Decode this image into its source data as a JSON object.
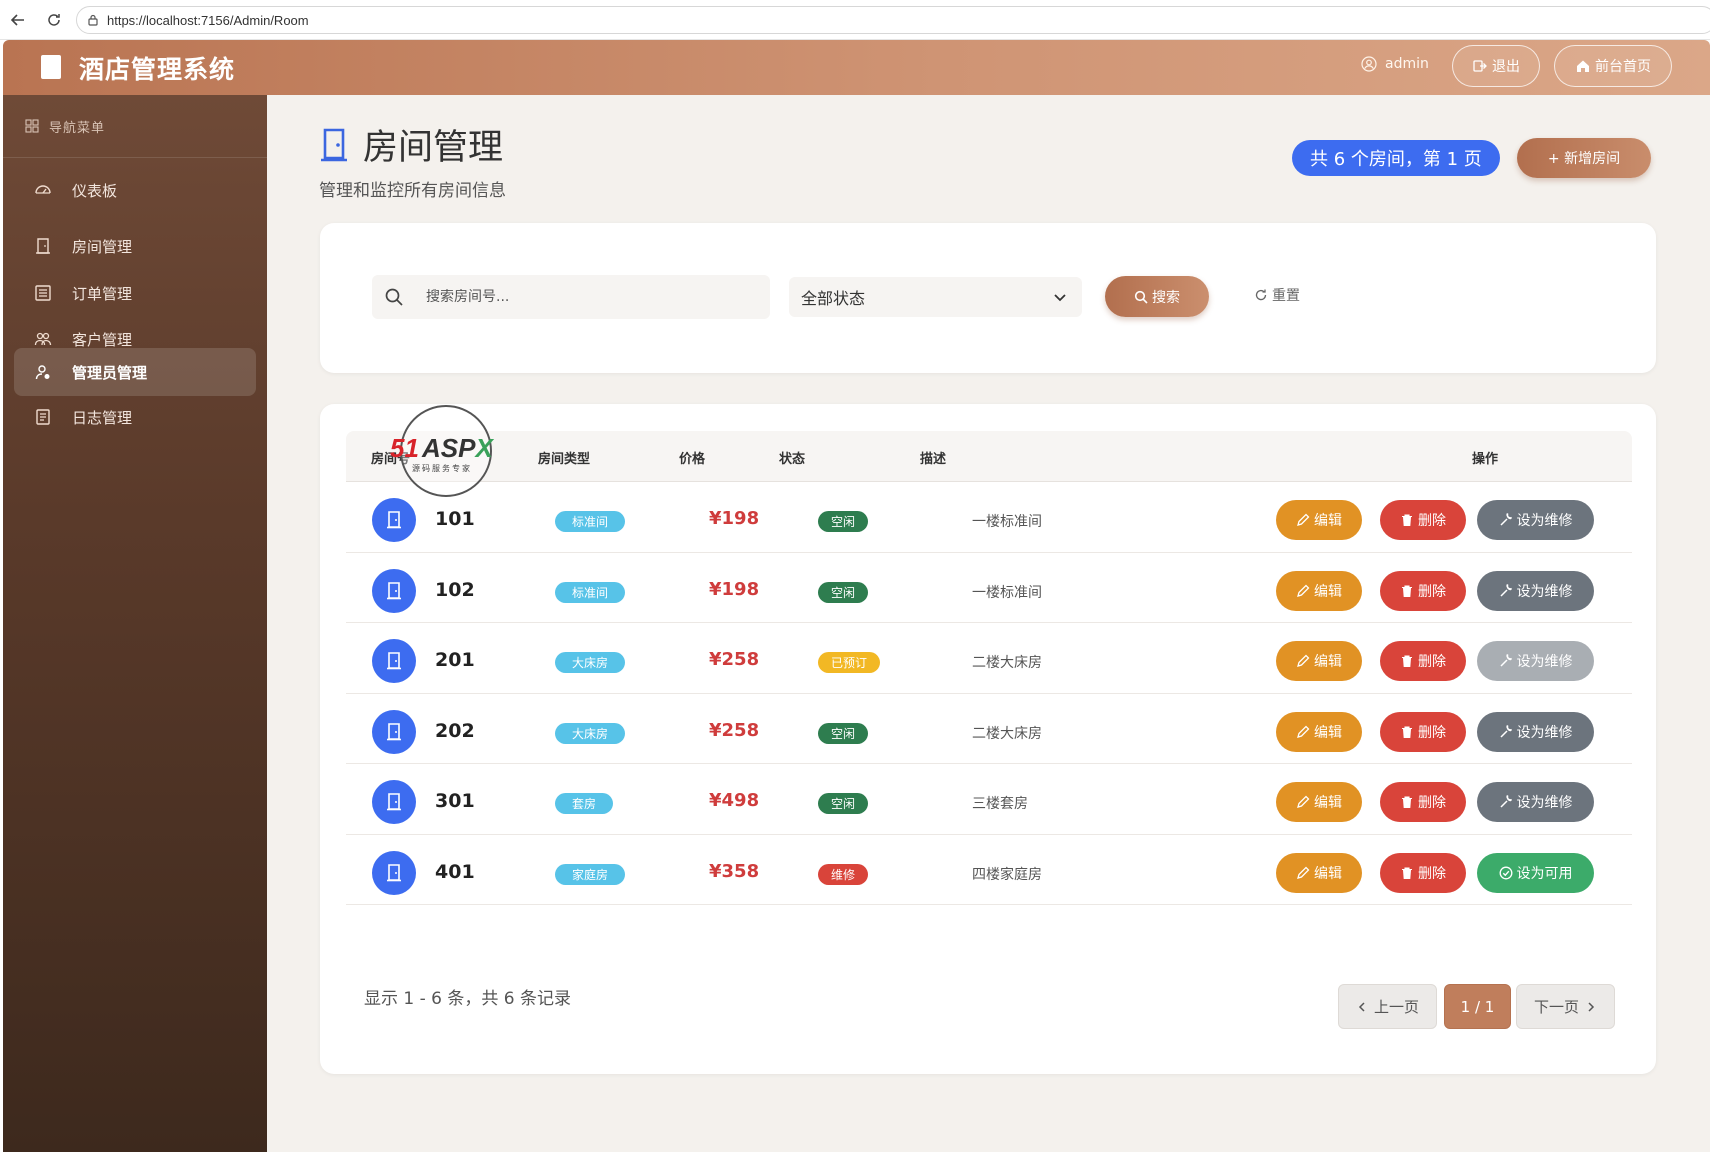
{
  "browser": {
    "url": "https://localhost:7156/Admin/Room"
  },
  "header": {
    "title": "酒店管理系统",
    "user": "admin",
    "logout_label": "退出",
    "front_label": "前台首页"
  },
  "sidebar": {
    "header": "导航菜单",
    "items": [
      {
        "label": "仪表板",
        "icon": "dashboard-icon"
      },
      {
        "label": "房间管理",
        "icon": "door-icon"
      },
      {
        "label": "订单管理",
        "icon": "order-icon"
      },
      {
        "label": "客户管理",
        "icon": "customers-icon"
      },
      {
        "label": "管理员管理",
        "icon": "admin-icon",
        "active": true
      },
      {
        "label": "日志管理",
        "icon": "log-icon"
      }
    ]
  },
  "page": {
    "title": "房间管理",
    "subtitle": "管理和监控所有房间信息",
    "count_badge": "共 6 个房间，第 1 页",
    "add_label": "+ 新增房间"
  },
  "search": {
    "placeholder": "搜索房间号...",
    "status_selected": "全部状态",
    "search_label": "搜索",
    "reset_label": "重置"
  },
  "table": {
    "headers": [
      "房间号",
      "房间类型",
      "价格",
      "状态",
      "描述",
      "操作"
    ],
    "rows": [
      {
        "no": "101",
        "type": "标准间",
        "price": "¥198",
        "status": "空闲",
        "status_color": "#2e7d4f",
        "desc": "一楼标准间",
        "action": "设为维修",
        "action_kind": "maint"
      },
      {
        "no": "102",
        "type": "标准间",
        "price": "¥198",
        "status": "空闲",
        "status_color": "#2e7d4f",
        "desc": "一楼标准间",
        "action": "设为维修",
        "action_kind": "maint"
      },
      {
        "no": "201",
        "type": "大床房",
        "price": "¥258",
        "status": "已预订",
        "status_color": "#f2b824",
        "desc": "二楼大床房",
        "action": "设为维修",
        "action_kind": "maint-disabled"
      },
      {
        "no": "202",
        "type": "大床房",
        "price": "¥258",
        "status": "空闲",
        "status_color": "#2e7d4f",
        "desc": "二楼大床房",
        "action": "设为维修",
        "action_kind": "maint"
      },
      {
        "no": "301",
        "type": "套房",
        "price": "¥498",
        "status": "空闲",
        "status_color": "#2e7d4f",
        "desc": "三楼套房",
        "action": "设为维修",
        "action_kind": "maint"
      },
      {
        "no": "401",
        "type": "家庭房",
        "price": "¥358",
        "status": "维修",
        "status_color": "#d9443a",
        "desc": "四楼家庭房",
        "action": "设为可用",
        "action_kind": "avail"
      }
    ],
    "edit_label": "编辑",
    "delete_label": "删除"
  },
  "pagination": {
    "info": "显示 1 - 6 条，共 6 条记录",
    "prev_label": "上一页",
    "current": "1 / 1",
    "next_label": "下一页"
  },
  "watermark": {
    "brand_a": "51",
    "brand_b": "ASP",
    "brand_c": "X",
    "tagline": "源码服务专家"
  },
  "colors": {
    "accent": "#c07e5c",
    "primary_blue": "#3d6cf0",
    "sidebar_top": "#6f4a37",
    "sidebar_bottom": "#3d291d"
  }
}
